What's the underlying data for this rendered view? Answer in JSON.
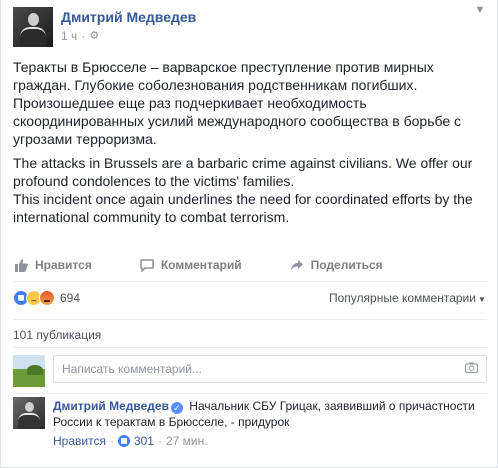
{
  "post": {
    "author": "Дмитрий Медведев",
    "time": "1 ч",
    "privacy_icon": "gear-icon",
    "menu_icon": "chevron-down-icon",
    "paragraphs": [
      "Теракты в Брюсселе – варварское преступление против мирных граждан. Глубокие соболезнования родственникам погибших. Произошедшее еще раз подчеркивает необходимость скоординированных усилий международного сообщества в борьбе с угрозами терроризма.",
      "The attacks in Brussels are a barbaric crime against civilians. We offer our profound condolences to the victims' families.\nThis incident once again underlines the need for coordinated efforts by the international community to combat terrorism."
    ]
  },
  "actions": {
    "like": "Нравится",
    "comment": "Комментарий",
    "share": "Поделиться"
  },
  "reactions": {
    "types": [
      "like",
      "sad",
      "angry"
    ],
    "count": "694",
    "popular_comments": "Популярные комментарии"
  },
  "shares": "101 публикация",
  "comment_input": {
    "placeholder": "Написать комментарий..."
  },
  "comment": {
    "author": "Дмитрий Медведев",
    "text": "Начальник СБУ Грицак, заявивший о причастности России к терактам в Брюсселе, - придурок",
    "like_link": "Нравится",
    "likes": "301",
    "time": "27 мин."
  },
  "colors": {
    "link": "#365899",
    "muted": "#90949c",
    "text": "#1d2129",
    "like_blue": "#4080ff"
  }
}
